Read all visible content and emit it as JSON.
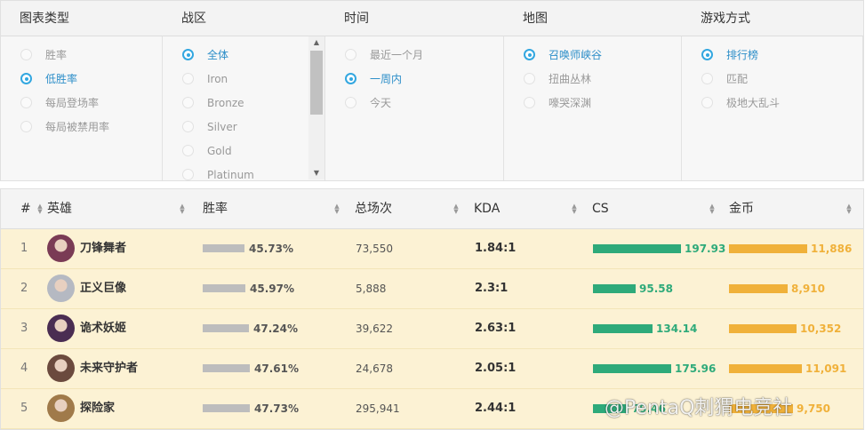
{
  "filters": {
    "chart_type": {
      "title": "图表类型",
      "options": [
        "胜率",
        "低胜率",
        "每局登场率",
        "每局被禁用率"
      ],
      "selected": 1
    },
    "region": {
      "title": "战区",
      "options": [
        "全体",
        "Iron",
        "Bronze",
        "Silver",
        "Gold",
        "Platinum"
      ],
      "selected": 0
    },
    "time": {
      "title": "时间",
      "options": [
        "最近一个月",
        "一周内",
        "今天"
      ],
      "selected": 1
    },
    "map": {
      "title": "地图",
      "options": [
        "召唤师峡谷",
        "扭曲丛林",
        "嚎哭深渊"
      ],
      "selected": 0
    },
    "mode": {
      "title": "游戏方式",
      "options": [
        "排行榜",
        "匹配",
        "极地大乱斗"
      ],
      "selected": 0
    }
  },
  "table": {
    "headers": {
      "rank": "#",
      "hero": "英雄",
      "winrate": "胜率",
      "games": "总场次",
      "kda": "KDA",
      "cs": "CS",
      "gold": "金币"
    },
    "rows": [
      {
        "rank": "1",
        "hero": "刀锋舞者",
        "winrate": "45.73%",
        "winrate_value": 45.73,
        "games": "73,550",
        "kda": "1.84:1",
        "cs": "197.93",
        "cs_value": 197.93,
        "gold": "11,886",
        "gold_value": 11886,
        "avatar_color": "#7a3b55"
      },
      {
        "rank": "2",
        "hero": "正义巨像",
        "winrate": "45.97%",
        "winrate_value": 45.97,
        "games": "5,888",
        "kda": "2.3:1",
        "cs": "95.58",
        "cs_value": 95.58,
        "gold": "8,910",
        "gold_value": 8910,
        "avatar_color": "#b5b9c2"
      },
      {
        "rank": "3",
        "hero": "诡术妖姬",
        "winrate": "47.24%",
        "winrate_value": 47.24,
        "games": "39,622",
        "kda": "2.63:1",
        "cs": "134.14",
        "cs_value": 134.14,
        "gold": "10,352",
        "gold_value": 10352,
        "avatar_color": "#4a2d52"
      },
      {
        "rank": "4",
        "hero": "未来守护者",
        "winrate": "47.61%",
        "winrate_value": 47.61,
        "games": "24,678",
        "kda": "2.05:1",
        "cs": "175.96",
        "cs_value": 175.96,
        "gold": "11,091",
        "gold_value": 11091,
        "avatar_color": "#6b4a3e"
      },
      {
        "rank": "5",
        "hero": "探险家",
        "winrate": "47.73%",
        "winrate_value": 47.73,
        "games": "295,941",
        "kda": "2.44:1",
        "cs": "79.46",
        "cs_value": 79.46,
        "gold": "9,750",
        "gold_value": 9750,
        "avatar_color": "#a07a4a"
      }
    ]
  },
  "watermark": "@PentaQ刺猬电竞社",
  "colors": {
    "accent": "#33a7e0",
    "cs": "#2eaa7a",
    "gold": "#f0b13a",
    "row_bg": "#fcf2d4"
  }
}
